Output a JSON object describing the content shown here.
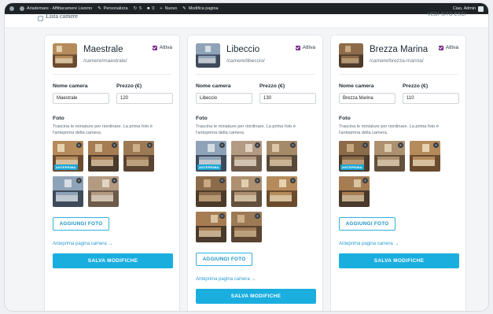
{
  "wpbar": {
    "site": "Ariademare - Affittacamere Livorno",
    "customize": "Personalizza",
    "updates": "5",
    "comments": "0",
    "new": "Nuovo",
    "edit": "Modifica pagina",
    "greeting": "Ciao, Admin"
  },
  "header": {
    "title": "Lista camere",
    "nav": "VEDI SITO    ESCI"
  },
  "labels": {
    "active": "Attiva",
    "name": "Nome camera",
    "price": "Prezzo (€)",
    "photos": "Foto",
    "help": "Trascina le miniature per riordinare. La prima foto è l'anteprima della camera.",
    "badge": "ANTEPRIMA",
    "add_photo": "AGGIUNGI FOTO",
    "preview_link": "Anteprima pagina camera →",
    "save": "SALVA MODIFICHE",
    "remove": "×"
  },
  "rooms": [
    {
      "name": "Maestrale",
      "path": "/camere/maestrale/",
      "name_value": "Maestrale",
      "price_value": "120",
      "photo_count": 5
    },
    {
      "name": "Libeccio",
      "path": "/camere/libeccio/",
      "name_value": "Libeccio",
      "price_value": "130",
      "photo_count": 8
    },
    {
      "name": "Brezza Marina",
      "path": "/camere/brezza-marina/",
      "name_value": "Brezza Marina",
      "price_value": "110",
      "photo_count": 4
    }
  ],
  "colors": {
    "accent": "#1aaedf",
    "check": "#7a2a8c",
    "adminbar": "#1d2327"
  }
}
